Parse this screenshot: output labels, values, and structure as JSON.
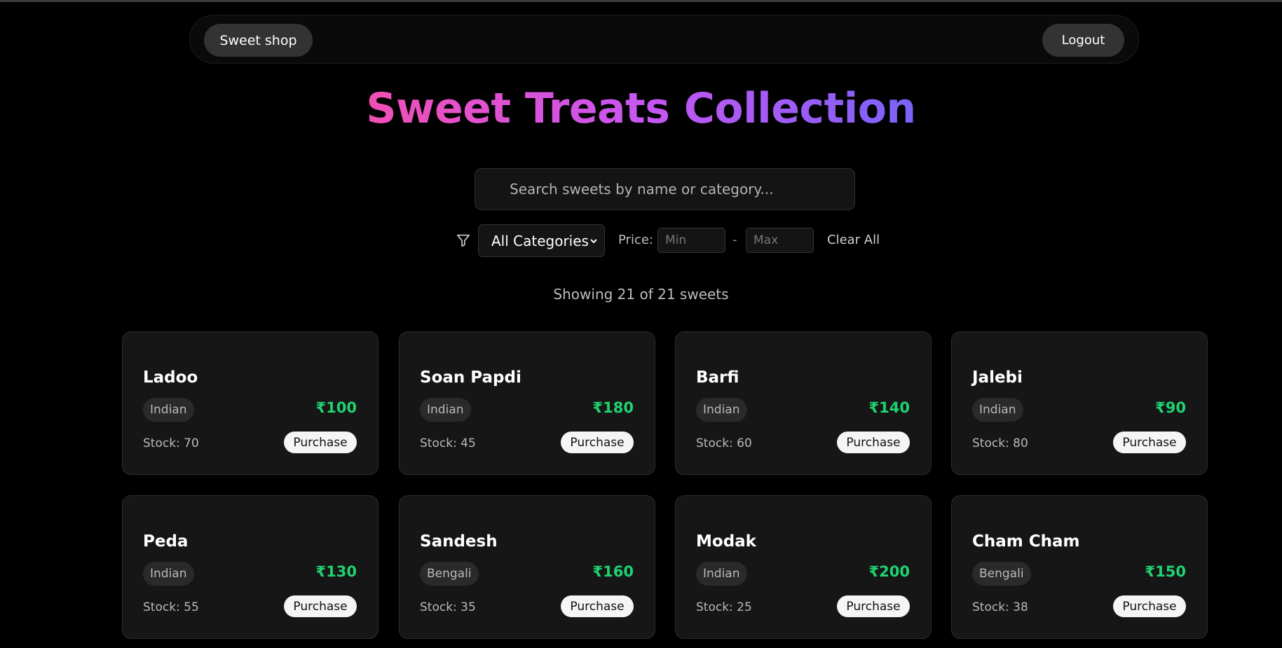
{
  "nav": {
    "brand": "Sweet shop",
    "logout": "Logout"
  },
  "page": {
    "title": "Sweet Treats Collection"
  },
  "search": {
    "placeholder": "Search sweets by name or category..."
  },
  "filters": {
    "category_selected": "All Categories",
    "price_label": "Price:",
    "min_placeholder": "Min",
    "separator": "-",
    "max_placeholder": "Max",
    "clear_all": "Clear All"
  },
  "summary": {
    "showing": "Showing 21 of 21 sweets"
  },
  "colors": {
    "price": "#1fd371",
    "gradient_start": "#f24fb4",
    "gradient_end": "#7a62f8"
  },
  "icons": {
    "filter": "filter-icon",
    "select": "chevron-down-icon"
  },
  "sweets": [
    {
      "name": "Ladoo",
      "category": "Indian",
      "price": "₹100",
      "stock": "Stock: 70",
      "action": "Purchase"
    },
    {
      "name": "Soan Papdi",
      "category": "Indian",
      "price": "₹180",
      "stock": "Stock: 45",
      "action": "Purchase"
    },
    {
      "name": "Barfi",
      "category": "Indian",
      "price": "₹140",
      "stock": "Stock: 60",
      "action": "Purchase"
    },
    {
      "name": "Jalebi",
      "category": "Indian",
      "price": "₹90",
      "stock": "Stock: 80",
      "action": "Purchase"
    },
    {
      "name": "Peda",
      "category": "Indian",
      "price": "₹130",
      "stock": "Stock: 55",
      "action": "Purchase"
    },
    {
      "name": "Sandesh",
      "category": "Bengali",
      "price": "₹160",
      "stock": "Stock: 35",
      "action": "Purchase"
    },
    {
      "name": "Modak",
      "category": "Indian",
      "price": "₹200",
      "stock": "Stock: 25",
      "action": "Purchase"
    },
    {
      "name": "Cham Cham",
      "category": "Bengali",
      "price": "₹150",
      "stock": "Stock: 38",
      "action": "Purchase"
    }
  ]
}
